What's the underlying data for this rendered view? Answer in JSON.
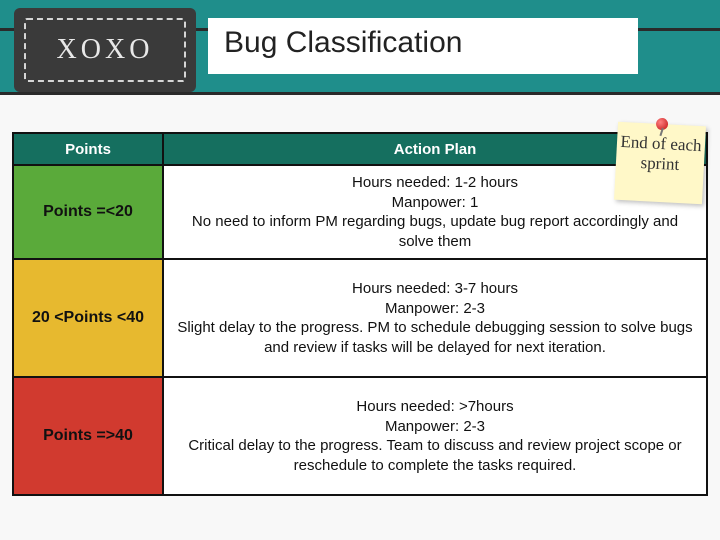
{
  "header": {
    "logo": "XOXO",
    "title": "Bug Classification"
  },
  "table": {
    "head_points": "Points",
    "head_action": "Action Plan",
    "rows": [
      {
        "label": "Points =<20",
        "action": "Hours needed: 1-2 hours\nManpower: 1\nNo need to inform PM regarding bugs, update bug report accordingly and solve them"
      },
      {
        "label": "20 <Points <40",
        "action": "Hours needed: 3-7 hours\nManpower: 2-3\nSlight delay to the progress. PM to schedule debugging session to solve bugs and review if tasks will be delayed for next iteration."
      },
      {
        "label": "Points =>40",
        "action": "Hours needed: >7hours\nManpower: 2-3\nCritical delay to the progress. Team to discuss and review project scope or reschedule to complete the tasks required."
      }
    ]
  },
  "sticky": {
    "text": "End of each sprint"
  }
}
